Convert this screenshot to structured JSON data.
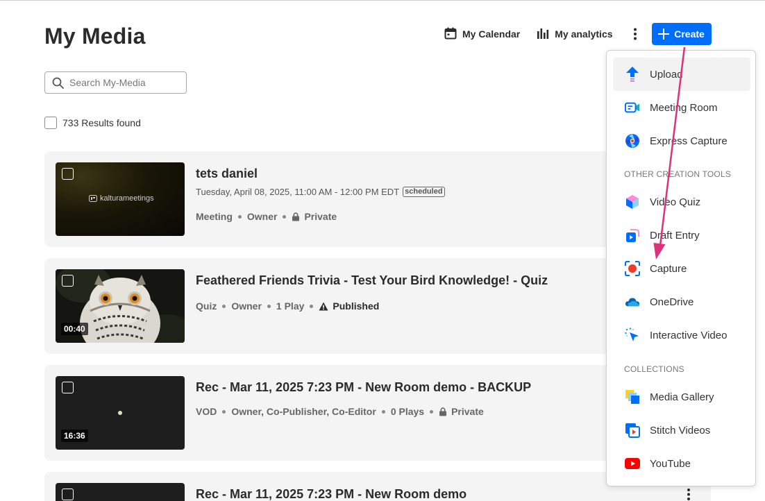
{
  "page": {
    "title": "My Media"
  },
  "header": {
    "calendar_label": "My Calendar",
    "analytics_label": "My analytics",
    "create_label": "Create"
  },
  "search": {
    "placeholder": "Search My-Media"
  },
  "results": {
    "text": "733 Results found"
  },
  "entries": [
    {
      "title": "tets daniel",
      "date": "Tuesday, April 08, 2025, 11:00 AM - 12:00 PM EDT",
      "badge": "scheduled",
      "thumb_text": "kalturameetings",
      "meta": [
        "Meeting",
        "Owner",
        "Private"
      ]
    },
    {
      "title": "Feathered Friends Trivia - Test Your Bird Knowledge! - Quiz",
      "duration": "00:40",
      "meta": [
        "Quiz",
        "Owner",
        "1 Play",
        "Published"
      ]
    },
    {
      "title": "Rec - Mar 11, 2025 7:23 PM - New Room demo - BACKUP",
      "duration": "16:36",
      "meta": [
        "VOD",
        "Owner, Co-Publisher, Co-Editor",
        "0 Plays",
        "Private"
      ]
    },
    {
      "title": "Rec - Mar 11, 2025 7:23 PM - New Room demo"
    }
  ],
  "dropdown": {
    "items_top": [
      {
        "label": "Upload",
        "icon": "upload-icon"
      },
      {
        "label": "Meeting Room",
        "icon": "meeting-room-icon"
      },
      {
        "label": "Express Capture",
        "icon": "express-capture-icon"
      }
    ],
    "section_other": "OTHER CREATION TOOLS",
    "items_other": [
      {
        "label": "Video Quiz",
        "icon": "video-quiz-icon"
      },
      {
        "label": "Draft Entry",
        "icon": "draft-entry-icon"
      },
      {
        "label": "Capture",
        "icon": "capture-icon"
      },
      {
        "label": "OneDrive",
        "icon": "onedrive-icon"
      },
      {
        "label": "Interactive Video",
        "icon": "interactive-video-icon"
      }
    ],
    "section_collections": "COLLECTIONS",
    "items_collections": [
      {
        "label": "Media Gallery",
        "icon": "media-gallery-icon"
      },
      {
        "label": "Stitch Videos",
        "icon": "stitch-videos-icon"
      },
      {
        "label": "YouTube",
        "icon": "youtube-icon"
      }
    ]
  },
  "colors": {
    "accent": "#006efa",
    "annotation_arrow": "#e0307a",
    "youtube": "#ff0000",
    "capture": "#ef3b2c"
  }
}
